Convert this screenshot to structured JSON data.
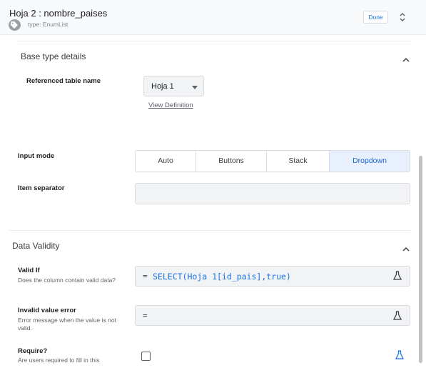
{
  "header": {
    "title": "Hoja 2 : nombre_paises",
    "type_label": "type:",
    "type_value": "EnumList",
    "done_label": "Done",
    "tag_icon": "tag-icon",
    "expand_icon": "unfold-icon"
  },
  "base_type": {
    "section_title": "Base type details",
    "ref_table_label": "Referenced table name",
    "ref_table_value": "Hoja 1",
    "view_definition": "View Definition",
    "input_mode_label": "Input mode",
    "input_modes": [
      "Auto",
      "Buttons",
      "Stack",
      "Dropdown"
    ],
    "input_mode_selected": "Dropdown",
    "item_separator_label": "Item separator",
    "item_separator_value": ""
  },
  "data_validity": {
    "section_title": "Data Validity",
    "valid_if_label": "Valid If",
    "valid_if_desc": "Does the column contain valid data?",
    "valid_if_eq": "=",
    "valid_if_expr": "SELECT(Hoja 1[id_pais],true)",
    "invalid_error_label": "Invalid value error",
    "invalid_error_desc": "Error message when the value is not valid.",
    "invalid_error_eq": "=",
    "invalid_error_expr": "",
    "require_label": "Require?",
    "require_desc": "Are users required to fill in this",
    "require_checked": false
  },
  "colors": {
    "accent": "#1a73e8",
    "active_segment_bg": "#e8f0fe",
    "field_bg": "#f1f3f4"
  }
}
